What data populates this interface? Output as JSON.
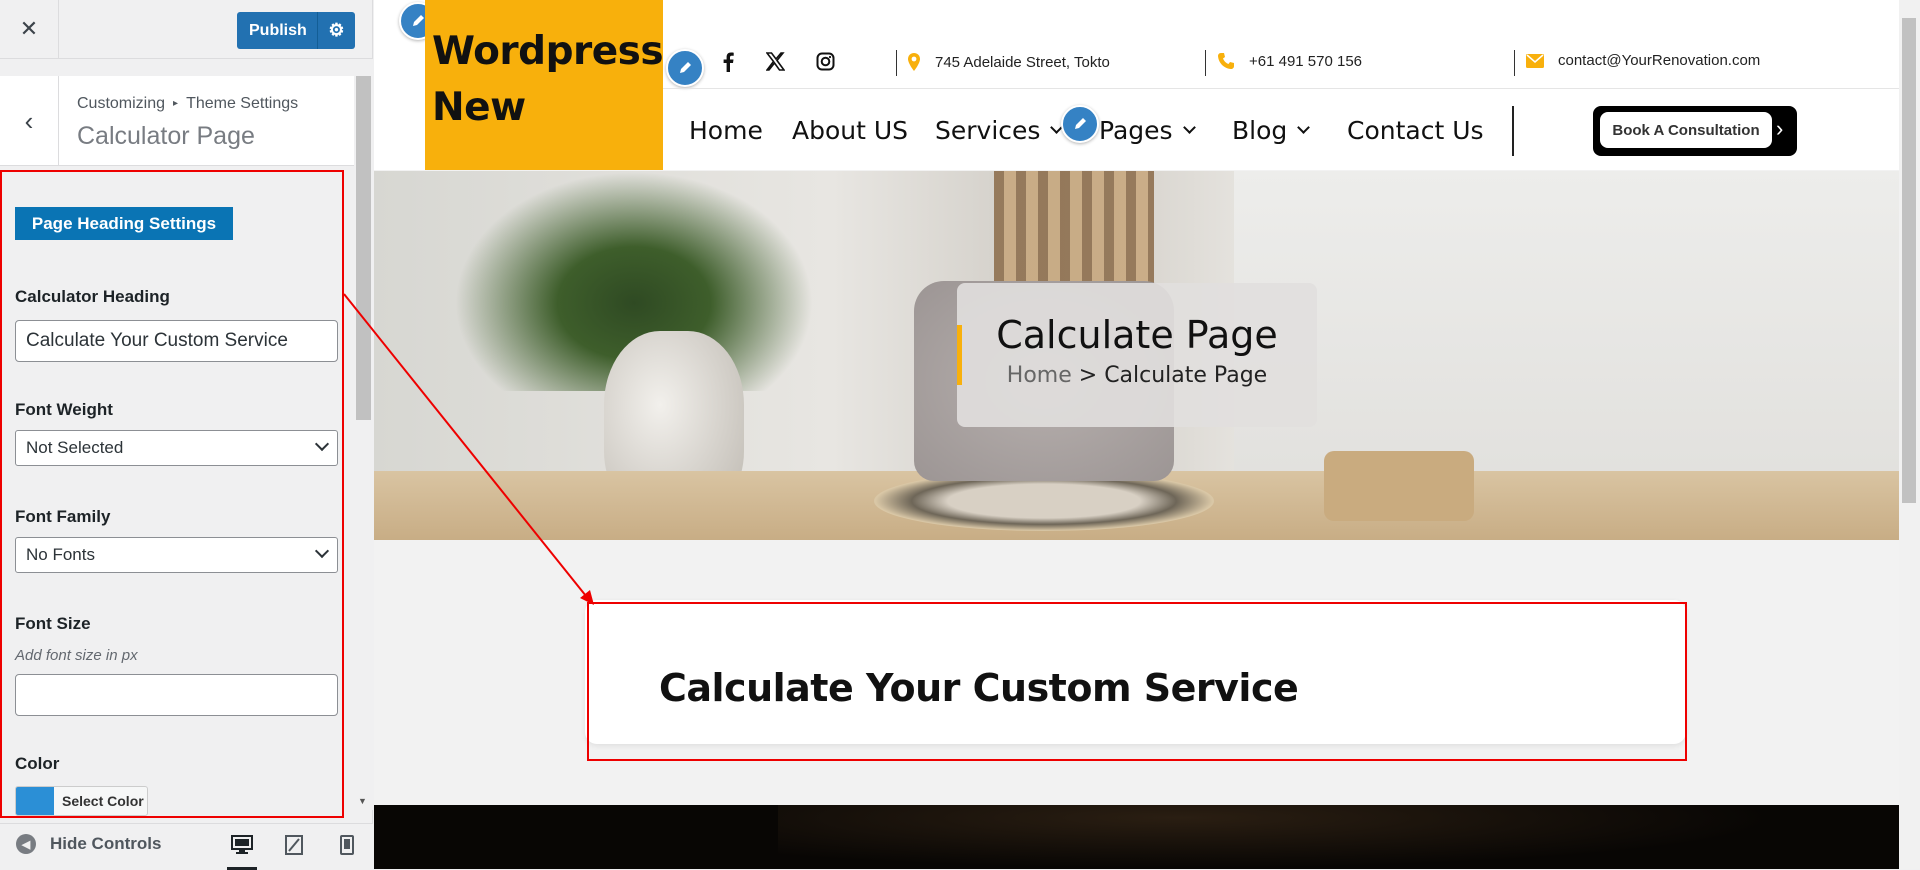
{
  "customizer": {
    "close_icon": "close-icon",
    "publish_label": "Publish",
    "breadcrumb": {
      "root": "Customizing",
      "separator": "▸",
      "parent": "Theme Settings"
    },
    "section_title": "Calculator Page",
    "panel": {
      "group_heading": "Page Heading Settings",
      "calculator_heading_label": "Calculator Heading",
      "calculator_heading_value": "Calculate Your Custom Service",
      "font_weight_label": "Font Weight",
      "font_weight_value": "Not Selected",
      "font_family_label": "Font Family",
      "font_family_value": "No Fonts",
      "font_size_label": "Font Size",
      "font_size_description": "Add font size in px",
      "font_size_value": "",
      "color_label": "Color",
      "color_button_label": "Select Color",
      "color_value": "#2b8fd6"
    },
    "footer": {
      "hide_controls_label": "Hide Controls",
      "devices": [
        "desktop",
        "tablet",
        "mobile"
      ],
      "active_device": "desktop"
    }
  },
  "site": {
    "logo_text": "Wordpress New",
    "social": [
      "facebook-icon",
      "x-icon",
      "instagram-icon"
    ],
    "contact": {
      "address": "745 Adelaide Street, Tokto",
      "phone": "+61 491 570 156",
      "email": "contact@YourRenovation.com"
    },
    "nav": [
      {
        "label": "Home",
        "dropdown": false
      },
      {
        "label": "About US",
        "dropdown": false
      },
      {
        "label": "Services",
        "dropdown": true
      },
      {
        "label": "Pages",
        "dropdown": true
      },
      {
        "label": "Blog",
        "dropdown": true
      },
      {
        "label": "Contact Us",
        "dropdown": false
      }
    ],
    "cta_label": "Book A Consultation",
    "hero": {
      "title": "Calculate Page",
      "breadcrumb_home": "Home",
      "breadcrumb_sep": ">",
      "breadcrumb_current": "Calculate Page"
    },
    "calculator_heading": "Calculate Your Custom Service",
    "colors": {
      "accent": "#f8b00c",
      "highlight": "#e00000",
      "publish": "#2271b1",
      "panel_pill": "#0a74b4"
    }
  }
}
